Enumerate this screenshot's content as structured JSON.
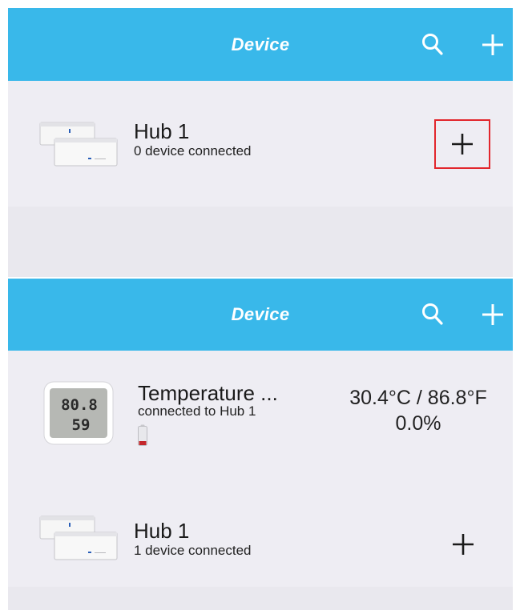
{
  "screens": [
    {
      "header": {
        "title": "Device",
        "search_icon": "search-icon",
        "add_icon": "plus-icon"
      },
      "devices": [
        {
          "name": "Hub 1",
          "status": "0 device connected",
          "action_icon": "plus-icon",
          "highlighted": true
        }
      ]
    },
    {
      "header": {
        "title": "Device",
        "search_icon": "search-icon",
        "add_icon": "plus-icon"
      },
      "devices": [
        {
          "name": "Temperature ...",
          "status": "connected to Hub 1",
          "temperature": "30.4°C / 86.8°F",
          "humidity": "0.0%",
          "battery_level": 0.2,
          "thumb_display": {
            "top": "80.8",
            "bottom": "59"
          }
        },
        {
          "name": "Hub 1",
          "status": "1 device connected",
          "action_icon": "plus-icon"
        }
      ]
    }
  ],
  "colors": {
    "header": "#39b8ea",
    "background": "#efeef4",
    "highlight": "#e2262c",
    "battery_low": "#c4272b"
  }
}
